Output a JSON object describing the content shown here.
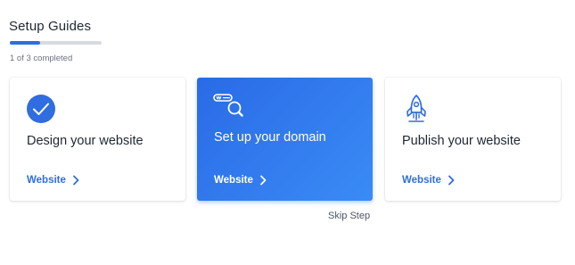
{
  "header": {
    "title": "Setup Guides",
    "progress_text": "1 of 3 completed",
    "progress_fraction": 0.333
  },
  "cards": [
    {
      "title": "Design your website",
      "link": "Website",
      "icon": "check-circle-icon",
      "completed": true
    },
    {
      "title": "Set up your domain",
      "link": "Website",
      "icon": "domain-search-icon",
      "active": true
    },
    {
      "title": "Publish your website",
      "link": "Website",
      "icon": "rocket-icon"
    }
  ],
  "skip_label": "Skip Step",
  "colors": {
    "accent": "#2f6de0",
    "active_card_start": "#2a6ae6",
    "active_card_end": "#3a8bf6",
    "text": "#1f2733"
  }
}
